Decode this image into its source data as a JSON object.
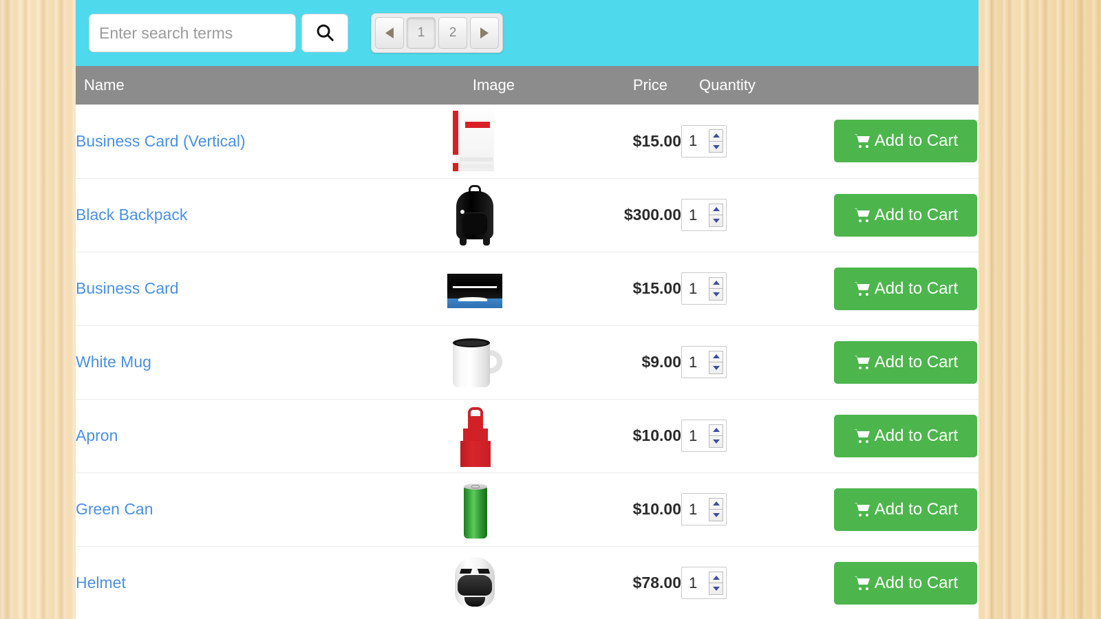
{
  "toolbar": {
    "search_placeholder": "Enter search terms",
    "search_value": "",
    "search_button_icon": "search-icon",
    "pagination": {
      "prev_label": "◄",
      "next_label": "►",
      "pages": [
        "1",
        "2"
      ],
      "active_page": "1"
    }
  },
  "table": {
    "columns": [
      "Name",
      "Image",
      "Price",
      "Quantity",
      ""
    ],
    "rows": [
      {
        "name": "Business Card (Vertical)",
        "image": "business-card-vertical-thumbnail",
        "price": "$15.00",
        "quantity": "1",
        "action_label": "Add to Cart"
      },
      {
        "name": "Black Backpack",
        "image": "black-backpack-thumbnail",
        "price": "$300.00",
        "quantity": "1",
        "action_label": "Add to Cart"
      },
      {
        "name": "Business Card",
        "image": "business-card-thumbnail",
        "price": "$15.00",
        "quantity": "1",
        "action_label": "Add to Cart"
      },
      {
        "name": "White Mug",
        "image": "white-mug-thumbnail",
        "price": "$9.00",
        "quantity": "1",
        "action_label": "Add to Cart"
      },
      {
        "name": "Apron",
        "image": "apron-thumbnail",
        "price": "$10.00",
        "quantity": "1",
        "action_label": "Add to Cart"
      },
      {
        "name": "Green Can",
        "image": "green-can-thumbnail",
        "price": "$10.00",
        "quantity": "1",
        "action_label": "Add to Cart"
      },
      {
        "name": "Helmet",
        "image": "helmet-thumbnail",
        "price": "$78.00",
        "quantity": "1",
        "action_label": "Add to Cart"
      }
    ]
  },
  "colors": {
    "toolbar_background": "#4FD9EC",
    "table_header_background": "#8C8C8C",
    "link": "#4A90E2",
    "add_to_cart_button": "#4CB64C",
    "page_background_wood": "#F2D9A8"
  }
}
